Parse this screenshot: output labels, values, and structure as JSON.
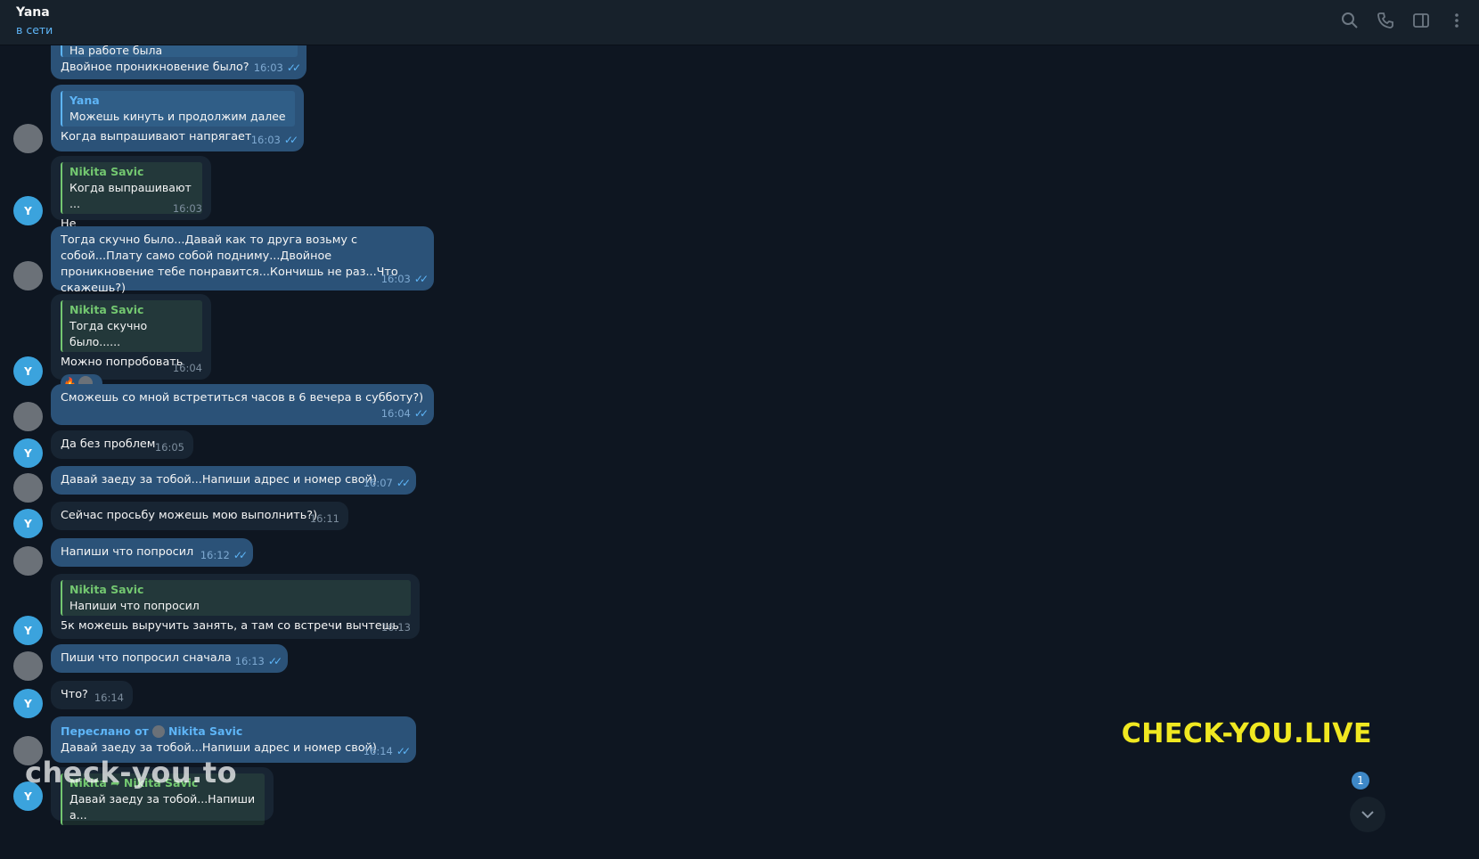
{
  "header": {
    "name": "Yana",
    "status": "в сети"
  },
  "messages": [
    {
      "quote_text": "На работе была",
      "text": "Двойное проникновение было?",
      "time": "16:03"
    },
    {
      "quote_name": "Yana",
      "quote_text": "Можешь кинуть и продолжим далее",
      "text": "Когда выпрашивают напрягает",
      "time": "16:03"
    },
    {
      "quote_name": "Nikita Savic",
      "quote_text": "Когда выпрашивают ...",
      "text": "Не",
      "time": "16:03"
    },
    {
      "text": "Тогда скучно было...Давай как то друга возьму с собой...Плату само собой подниму...Двойное проникновение тебе понравится...Кончишь не раз...Что скажешь?)",
      "time": "16:03"
    },
    {
      "quote_name": "Nikita Savic",
      "quote_text": "Тогда скучно было......",
      "text": "Можно попробовать",
      "time": "16:04",
      "reaction": "🔥"
    },
    {
      "text": "Сможешь со мной встретиться часов в 6 вечера в субботу?)",
      "time": "16:04"
    },
    {
      "text": "Да без проблем",
      "time": "16:05"
    },
    {
      "text": "Давай заеду за тобой...Напиши адрес и номер свой)",
      "time": "16:07"
    },
    {
      "text": "Сейчас просьбу можешь мою выполнить?)",
      "time": "16:11"
    },
    {
      "text": "Напиши что попросил",
      "time": "16:12"
    },
    {
      "quote_name": "Nikita Savic",
      "quote_text": "Напиши что попросил",
      "text": "5к можешь выручить занять, а там со встречи вычтешь",
      "time": "16:13"
    },
    {
      "text": "Пиши что попросил сначала",
      "time": "16:13"
    },
    {
      "text": "Что?",
      "time": "16:14"
    },
    {
      "fwd_label": "Переслано от",
      "fwd_name": "Nikita Savic",
      "text": "Давай заеду за тобой...Напиши адрес и номер свой)",
      "time": "16:14"
    },
    {
      "quote_name": "Nikita ➦ Nikita Savic",
      "quote_text": "Давай заеду за тобой...Напиши а..."
    }
  ],
  "avatar_letter": "Y",
  "watermark_left": "check-you.to",
  "watermark_right": "CHECK-YOU.LIVE",
  "unread_count": "1"
}
